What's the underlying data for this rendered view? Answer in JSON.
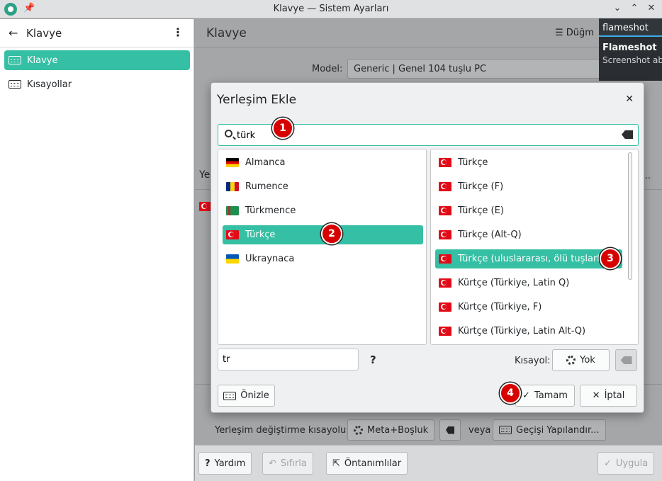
{
  "window": {
    "title": "Klavye — Sistem Ayarları"
  },
  "sidebar": {
    "title": "Klavye",
    "items": [
      {
        "label": "Klavye",
        "active": true
      },
      {
        "label": "Kısayollar",
        "active": false
      }
    ]
  },
  "main": {
    "title": "Klavye",
    "header_button": "Düğm",
    "model_label": "Model:",
    "model_value": "Generic | Genel 104 tuşlu PC",
    "section_fragment": "Ye",
    "ellipsis": "...",
    "switch_label": "Yerleşim değiştirme kısayolu:",
    "switch_shortcut": "Meta+Boşluk",
    "or_label": "veya",
    "switch_config_button": "Geçişi Yapılandır...",
    "footer": {
      "help": "Yardım",
      "reset": "Sıfırla",
      "defaults": "Öntanımlılar",
      "apply": "Uygula"
    }
  },
  "notification": {
    "app": "flameshot",
    "title": "Flameshot",
    "body": "Screenshot ab"
  },
  "dialog": {
    "title": "Yerleşim Ekle",
    "search": {
      "value": "türk"
    },
    "languages": [
      {
        "label": "Almanca",
        "flag": "de"
      },
      {
        "label": "Rumence",
        "flag": "ro"
      },
      {
        "label": "Türkmence",
        "flag": "tm"
      },
      {
        "label": "Türkçe",
        "flag": "tr",
        "selected": true
      },
      {
        "label": "Ukraynaca",
        "flag": "ua"
      }
    ],
    "variants": [
      {
        "label": "Türkçe",
        "flag": "tr"
      },
      {
        "label": "Türkçe (F)",
        "flag": "tr"
      },
      {
        "label": "Türkçe (E)",
        "flag": "tr"
      },
      {
        "label": "Türkçe (Alt-Q)",
        "flag": "tr"
      },
      {
        "label": "Türkçe (uluslararası, ölü tuşlarla)",
        "flag": "tr",
        "selected": true
      },
      {
        "label": "Kürtçe (Türkiye, Latin Q)",
        "flag": "tr"
      },
      {
        "label": "Kürtçe (Türkiye, F)",
        "flag": "tr"
      },
      {
        "label": "Kürtçe (Türkiye, Latin Alt-Q)",
        "flag": "tr"
      }
    ],
    "variant_name_value": "tr",
    "help_mark": "?",
    "shortcut_label": "Kısayol:",
    "shortcut_value": "Yok",
    "preview_button": "Önizle",
    "ok_button": "Tamam",
    "cancel_button": "İptal"
  },
  "badges": [
    "1",
    "2",
    "3",
    "4"
  ],
  "colors": {
    "accent": "#35bfa4",
    "badge": "#d60000"
  }
}
